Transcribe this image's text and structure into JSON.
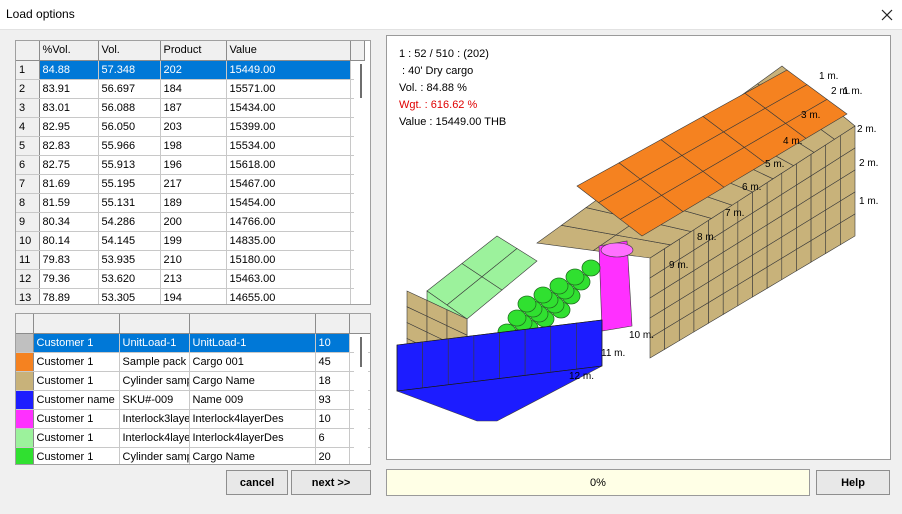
{
  "window": {
    "title": "Load options"
  },
  "results": {
    "columns": [
      "%Vol.",
      "Vol.",
      "Product",
      "Value"
    ],
    "rows": [
      {
        "n": "1",
        "vol_pct": "84.88",
        "vol": "57.348",
        "product": "202",
        "value": "15449.00"
      },
      {
        "n": "2",
        "vol_pct": "83.91",
        "vol": "56.697",
        "product": "184",
        "value": "15571.00"
      },
      {
        "n": "3",
        "vol_pct": "83.01",
        "vol": "56.088",
        "product": "187",
        "value": "15434.00"
      },
      {
        "n": "4",
        "vol_pct": "82.95",
        "vol": "56.050",
        "product": "203",
        "value": "15399.00"
      },
      {
        "n": "5",
        "vol_pct": "82.83",
        "vol": "55.966",
        "product": "198",
        "value": "15534.00"
      },
      {
        "n": "6",
        "vol_pct": "82.75",
        "vol": "55.913",
        "product": "196",
        "value": "15618.00"
      },
      {
        "n": "7",
        "vol_pct": "81.69",
        "vol": "55.195",
        "product": "217",
        "value": "15467.00"
      },
      {
        "n": "8",
        "vol_pct": "81.59",
        "vol": "55.131",
        "product": "189",
        "value": "15454.00"
      },
      {
        "n": "9",
        "vol_pct": "80.34",
        "vol": "54.286",
        "product": "200",
        "value": "14766.00"
      },
      {
        "n": "10",
        "vol_pct": "80.14",
        "vol": "54.145",
        "product": "199",
        "value": "14835.00"
      },
      {
        "n": "11",
        "vol_pct": "79.83",
        "vol": "53.935",
        "product": "210",
        "value": "15180.00"
      },
      {
        "n": "12",
        "vol_pct": "79.36",
        "vol": "53.620",
        "product": "213",
        "value": "15463.00"
      },
      {
        "n": "13",
        "vol_pct": "78.89",
        "vol": "53.305",
        "product": "194",
        "value": "14655.00"
      }
    ]
  },
  "cargo": {
    "rows": [
      {
        "color": "#c0c0c0",
        "customer": "Customer 1",
        "sku": "UnitLoad-1",
        "name": "UnitLoad-1",
        "qty": "10"
      },
      {
        "color": "#f58220",
        "customer": "Customer 1",
        "sku": "Sample pack",
        "name": "Cargo 001",
        "qty": "45"
      },
      {
        "color": "#c8b27a",
        "customer": "Customer 1",
        "sku": "Cylinder samp",
        "name": "Cargo Name",
        "qty": "18"
      },
      {
        "color": "#1c1cff",
        "customer": "Customer name",
        "sku": "SKU#-009",
        "name": "Name 009",
        "qty": "93"
      },
      {
        "color": "#ff30ff",
        "customer": "Customer 1",
        "sku": "Interlock3laye",
        "name": "Interlock4layerDes",
        "qty": "10"
      },
      {
        "color": "#9cf29c",
        "customer": "Customer 1",
        "sku": "Interlock4laye",
        "name": "Interlock4layerDes",
        "qty": "6"
      },
      {
        "color": "#30e030",
        "customer": "Customer 1",
        "sku": "Cylinder samp",
        "name": "Cargo Name",
        "qty": "20"
      }
    ]
  },
  "buttons": {
    "cancel": "cancel",
    "next": "next >>",
    "help": "Help"
  },
  "progress": {
    "text": "0%"
  },
  "viewer": {
    "info": [
      "1 : 52 / 510 : (202)",
      " : 40' Dry cargo",
      "Vol. : 84.88 %",
      "Wgt. : 616.62 %",
      "Value : 15449.00 THB"
    ],
    "length_marks": [
      "1 m.",
      "2 m.",
      "3 m.",
      "4 m.",
      "5 m.",
      "6 m.",
      "7 m.",
      "8 m.",
      "9 m.",
      "10 m.",
      "11 m.",
      "12 m."
    ],
    "width_marks": [
      "1 m.",
      "2 m."
    ],
    "height_marks": [
      "2 m.",
      "1 m."
    ],
    "colors": {
      "orange": "#f58220",
      "tan": "#c8b27a",
      "blue": "#1c1cff",
      "magenta": "#ff30ff",
      "lightgreen": "#9cf29c",
      "green": "#30e030"
    }
  }
}
